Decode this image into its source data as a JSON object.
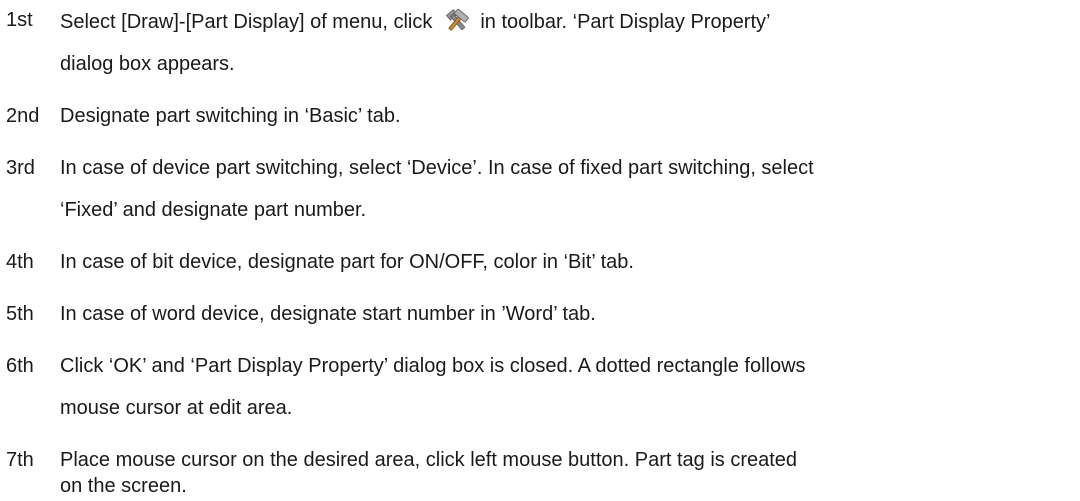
{
  "steps": [
    {
      "num": "1st",
      "text_before_icon": "Select [Draw]-[Part Display] of menu, click",
      "icon": "part-display-tool-icon",
      "text_after_icon": "in toolbar. ‘Part Display Property’",
      "continuation": "dialog box appears."
    },
    {
      "num": "2nd",
      "text": "Designate part switching in ‘Basic’ tab."
    },
    {
      "num": "3rd",
      "text": "In case of device part switching, select ‘Device’. In case of fixed part switching, select",
      "continuation": "‘Fixed’ and designate part number."
    },
    {
      "num": "4th",
      "text": "In case of bit device, designate part for ON/OFF, color in ‘Bit’ tab."
    },
    {
      "num": "5th",
      "text": "In case of word device, designate start number in ’Word’ tab."
    },
    {
      "num": "6th",
      "text": "Click ‘OK’ and ‘Part Display Property’ dialog box is closed. A dotted rectangle follows",
      "continuation": "mouse cursor at edit area."
    },
    {
      "num": "7th",
      "text": "Place mouse cursor on the desired area, click left mouse button. Part tag is created",
      "continuation": "on the screen."
    }
  ],
  "colors": {
    "text": "#1a1a1a",
    "background": "#ffffff"
  }
}
